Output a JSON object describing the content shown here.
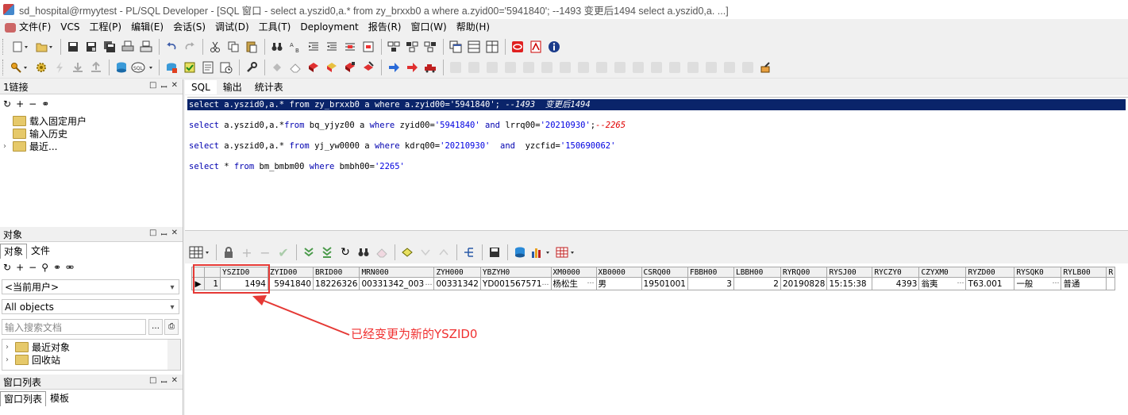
{
  "window": {
    "title": "sd_hospital@rmyytest - PL/SQL Developer - [SQL 窗口 - select a.yszid0,a.* from zy_brxxb0 a where a.zyid00='5941840'; --1493 变更后1494 select a.yszid0,a. ...]"
  },
  "menu": [
    "文件(F)",
    "VCS",
    "工程(P)",
    "编辑(E)",
    "会话(S)",
    "调试(D)",
    "工具(T)",
    "Deployment",
    "报告(R)",
    "窗口(W)",
    "帮助(H)"
  ],
  "connections_panel": {
    "title": "1链接",
    "tree": [
      "载入固定用户",
      "输入历史",
      "最近..."
    ]
  },
  "objects_panel": {
    "title": "对象",
    "tabs": [
      "对象",
      "文件"
    ],
    "user_combo": "<当前用户>",
    "filter_combo": "All objects",
    "search_placeholder": "输入搜索文档",
    "tree": [
      "最近对象",
      "回收站"
    ]
  },
  "window_list_panel": {
    "title": "窗口列表",
    "tabs": [
      "窗口列表",
      "模板"
    ]
  },
  "editor": {
    "tabs": [
      "SQL",
      "输出",
      "统计表"
    ],
    "lines": [
      {
        "parts": [
          [
            "kw",
            "select"
          ],
          [
            "t",
            " a.yszid0,a.* "
          ],
          [
            "kw",
            "from"
          ],
          [
            "t",
            " zy_brxxb0 a "
          ],
          [
            "kw",
            "where"
          ],
          [
            "t",
            " a.zyid00="
          ],
          [
            "str",
            "'5941840'"
          ],
          [
            "t",
            "; "
          ],
          [
            "cm",
            "--1493  变更后1494"
          ]
        ],
        "selected": true
      },
      {
        "parts": [
          [
            "kw",
            "select"
          ],
          [
            "t",
            " a.yszid0,a.*"
          ],
          [
            "kw",
            "from"
          ],
          [
            "t",
            " bq_yjyz00 a "
          ],
          [
            "kw",
            "where"
          ],
          [
            "t",
            " zyid00="
          ],
          [
            "str",
            "'5941840'"
          ],
          [
            "t",
            " "
          ],
          [
            "kw",
            "and"
          ],
          [
            "t",
            " lrrq00="
          ],
          [
            "str",
            "'20210930'"
          ],
          [
            "t",
            ";"
          ],
          [
            "cm",
            "--2265"
          ]
        ],
        "selected": false
      },
      {
        "parts": [
          [
            "kw",
            "select"
          ],
          [
            "t",
            " a.yszid0,a.* "
          ],
          [
            "kw",
            "from"
          ],
          [
            "t",
            " yj_yw0000 a "
          ],
          [
            "kw",
            "where"
          ],
          [
            "t",
            " kdrq00="
          ],
          [
            "str",
            "'20210930'"
          ],
          [
            "t",
            "  "
          ],
          [
            "kw",
            "and"
          ],
          [
            "t",
            "  yzcfid="
          ],
          [
            "str",
            "'150690062'"
          ]
        ],
        "selected": false
      },
      {
        "parts": [
          [
            "kw",
            "select"
          ],
          [
            "t",
            " * "
          ],
          [
            "kw",
            "from"
          ],
          [
            "t",
            " bm_bmbm00 "
          ],
          [
            "kw",
            "where"
          ],
          [
            "t",
            " bmbh00="
          ],
          [
            "str",
            "'2265'"
          ]
        ],
        "selected": false
      }
    ]
  },
  "grid": {
    "columns": [
      "YSZID0",
      "ZYID00",
      "BRID00",
      "MRN000",
      "ZYH000",
      "YBZYH0",
      "XM0000",
      "XB0000",
      "CSRQ00",
      "FBBH00",
      "LBBH00",
      "RYRQ00",
      "RYSJ00",
      "RYCZY0",
      "CZYXM0",
      "RYZD00",
      "RYSQK0",
      "RYLB00",
      "R"
    ],
    "rows": [
      {
        "num": "1",
        "cells": [
          "1494",
          "5941840",
          "18226326",
          "00331342_003",
          "00331342",
          "YD001567571",
          "杨松生",
          "男",
          "19501001",
          "3",
          "2",
          "20190828",
          "15:15:38",
          "4393",
          "翁夷",
          "T63.001",
          "一般",
          "普通",
          ""
        ]
      }
    ]
  },
  "annotation": {
    "text": "已经变更为新的YSZID0",
    "color": "#f03030"
  }
}
